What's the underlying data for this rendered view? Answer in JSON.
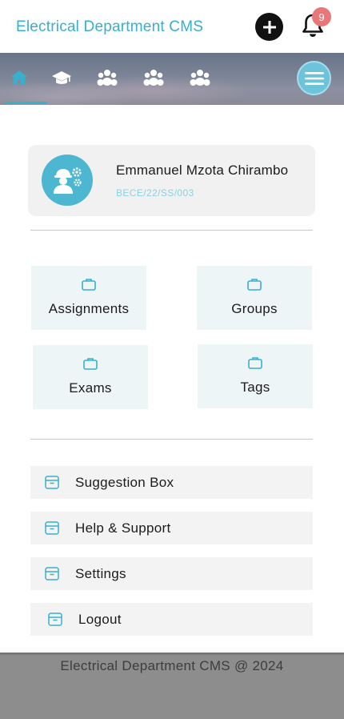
{
  "header": {
    "title": "Electrical Department CMS",
    "add_icon": "plus-circle-icon",
    "notifications_icon": "bell-icon",
    "notification_count": "9"
  },
  "nav": {
    "items": [
      {
        "icon": "home-icon",
        "active": true
      },
      {
        "icon": "graduation-cap-icon",
        "active": false
      },
      {
        "icon": "users-icon",
        "active": false
      },
      {
        "icon": "users-icon",
        "active": false
      },
      {
        "icon": "users-icon",
        "active": false
      }
    ],
    "menu_icon": "hamburger-menu-icon",
    "accent": "#37b0cc"
  },
  "profile": {
    "name": "Emmanuel Mzota Chirambo",
    "id": "BECE/22/SS/003",
    "avatar_icon": "engineer-gears-icon"
  },
  "tiles": [
    {
      "label": "Assignments",
      "icon": "briefcase-icon"
    },
    {
      "label": "Groups",
      "icon": "briefcase-icon"
    },
    {
      "label": "Exams",
      "icon": "briefcase-icon"
    },
    {
      "label": "Tags",
      "icon": "briefcase-icon"
    }
  ],
  "menu_list": [
    {
      "label": "Suggestion Box",
      "icon": "archive-box-icon"
    },
    {
      "label": "Help & Support",
      "icon": "archive-box-icon"
    },
    {
      "label": "Settings",
      "icon": "archive-box-icon"
    },
    {
      "label": "Logout",
      "icon": "archive-box-icon"
    }
  ],
  "footer": {
    "text": "Electrical Department CMS @ 2024"
  }
}
